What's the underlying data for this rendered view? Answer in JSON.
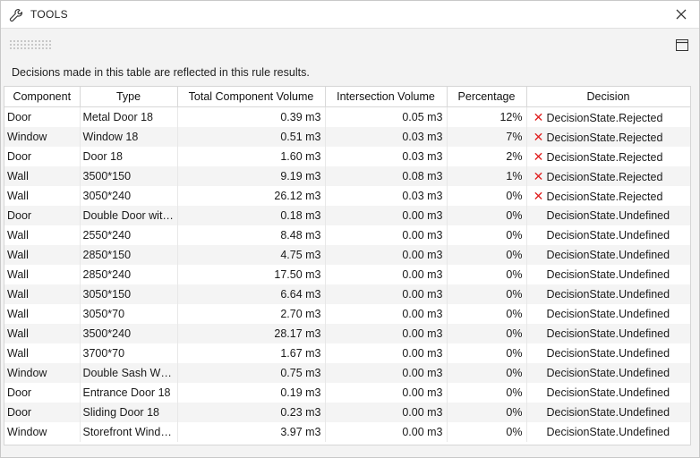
{
  "window": {
    "title": "TOOLS"
  },
  "info_text": "Decisions made in this table are reflected in this rule results.",
  "columns": [
    "Component",
    "Type",
    "Total Component Volume",
    "Intersection Volume",
    "Percentage",
    "Decision"
  ],
  "rows": [
    {
      "component": "Door",
      "type": "Metal Door 18",
      "total": "0.39 m3",
      "intersection": "0.05 m3",
      "percentage": "12%",
      "decision": "DecisionState.Rejected",
      "rejected": true
    },
    {
      "component": "Window",
      "type": "Window 18",
      "total": "0.51 m3",
      "intersection": "0.03 m3",
      "percentage": "7%",
      "decision": "DecisionState.Rejected",
      "rejected": true
    },
    {
      "component": "Door",
      "type": "Door 18",
      "total": "1.60 m3",
      "intersection": "0.03 m3",
      "percentage": "2%",
      "decision": "DecisionState.Rejected",
      "rejected": true
    },
    {
      "component": "Wall",
      "type": "3500*150",
      "total": "9.19 m3",
      "intersection": "0.08 m3",
      "percentage": "1%",
      "decision": "DecisionState.Rejected",
      "rejected": true
    },
    {
      "component": "Wall",
      "type": "3050*240",
      "total": "26.12 m3",
      "intersection": "0.03 m3",
      "percentage": "0%",
      "decision": "DecisionState.Rejected",
      "rejected": true
    },
    {
      "component": "Door",
      "type": "Double Door wit…",
      "total": "0.18 m3",
      "intersection": "0.00 m3",
      "percentage": "0%",
      "decision": "DecisionState.Undefined",
      "rejected": false
    },
    {
      "component": "Wall",
      "type": "2550*240",
      "total": "8.48 m3",
      "intersection": "0.00 m3",
      "percentage": "0%",
      "decision": "DecisionState.Undefined",
      "rejected": false
    },
    {
      "component": "Wall",
      "type": "2850*150",
      "total": "4.75 m3",
      "intersection": "0.00 m3",
      "percentage": "0%",
      "decision": "DecisionState.Undefined",
      "rejected": false
    },
    {
      "component": "Wall",
      "type": "2850*240",
      "total": "17.50 m3",
      "intersection": "0.00 m3",
      "percentage": "0%",
      "decision": "DecisionState.Undefined",
      "rejected": false
    },
    {
      "component": "Wall",
      "type": "3050*150",
      "total": "6.64 m3",
      "intersection": "0.00 m3",
      "percentage": "0%",
      "decision": "DecisionState.Undefined",
      "rejected": false
    },
    {
      "component": "Wall",
      "type": "3050*70",
      "total": "2.70 m3",
      "intersection": "0.00 m3",
      "percentage": "0%",
      "decision": "DecisionState.Undefined",
      "rejected": false
    },
    {
      "component": "Wall",
      "type": "3500*240",
      "total": "28.17 m3",
      "intersection": "0.00 m3",
      "percentage": "0%",
      "decision": "DecisionState.Undefined",
      "rejected": false
    },
    {
      "component": "Wall",
      "type": "3700*70",
      "total": "1.67 m3",
      "intersection": "0.00 m3",
      "percentage": "0%",
      "decision": "DecisionState.Undefined",
      "rejected": false
    },
    {
      "component": "Window",
      "type": "Double Sash Wi…",
      "total": "0.75 m3",
      "intersection": "0.00 m3",
      "percentage": "0%",
      "decision": "DecisionState.Undefined",
      "rejected": false
    },
    {
      "component": "Door",
      "type": "Entrance Door 18",
      "total": "0.19 m3",
      "intersection": "0.00 m3",
      "percentage": "0%",
      "decision": "DecisionState.Undefined",
      "rejected": false
    },
    {
      "component": "Door",
      "type": "Sliding Door 18",
      "total": "0.23 m3",
      "intersection": "0.00 m3",
      "percentage": "0%",
      "decision": "DecisionState.Undefined",
      "rejected": false
    },
    {
      "component": "Window",
      "type": "Storefront Wind…",
      "total": "3.97 m3",
      "intersection": "0.00 m3",
      "percentage": "0%",
      "decision": "DecisionState.Undefined",
      "rejected": false
    }
  ],
  "icons": {
    "title": "wrench-icon",
    "close": "close-icon",
    "panel": "panel-toggle-icon",
    "rejected": "rejected-x-icon"
  },
  "colors": {
    "rejected": "#e02020",
    "row_alt": "#f4f4f4"
  }
}
